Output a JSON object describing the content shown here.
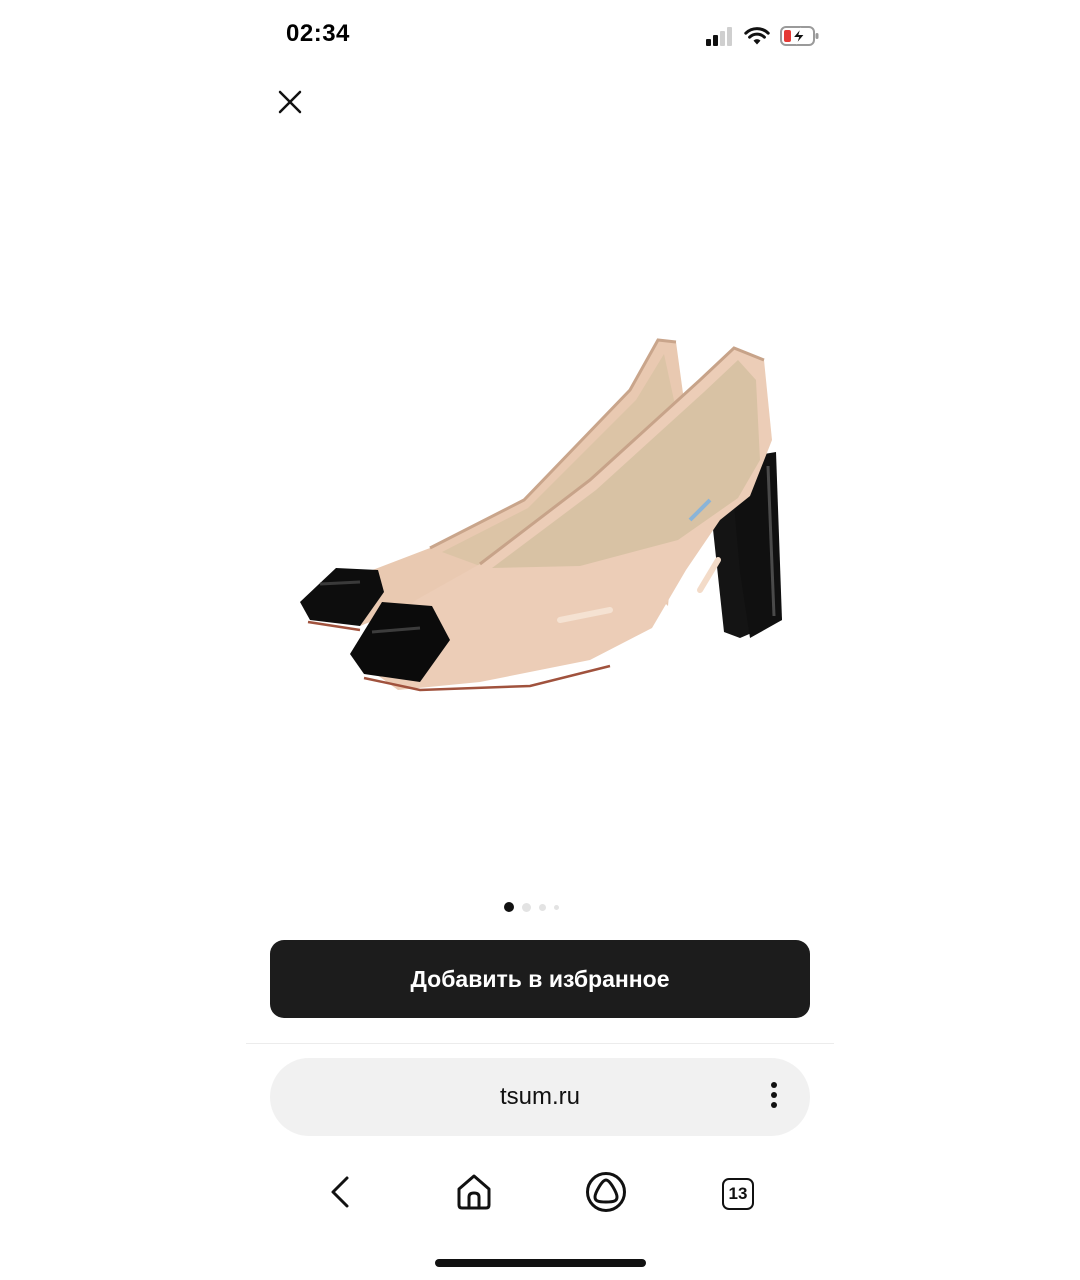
{
  "status_bar": {
    "time": "02:34",
    "icons": [
      "cellular-signal-icon",
      "wifi-icon",
      "battery-charging-icon"
    ],
    "battery_color": "#e53935"
  },
  "close_icon": "close-icon",
  "product": {
    "image": "two-tone-pumps-photo",
    "colors": {
      "body": "#e9c9b1",
      "cap": "#111111",
      "heel": "#141414"
    }
  },
  "pager": {
    "count": 4,
    "active": 1
  },
  "favorite_button": {
    "label": "Добавить в избранное",
    "color": "#1c1c1c"
  },
  "browser": {
    "url": "tsum.ru",
    "menu_icon": "more-vertical-icon",
    "nav": {
      "back_icon": "back-chevron-icon",
      "home_icon": "home-icon",
      "assistant_icon": "assistant-icon",
      "tabs_count": "13"
    }
  }
}
